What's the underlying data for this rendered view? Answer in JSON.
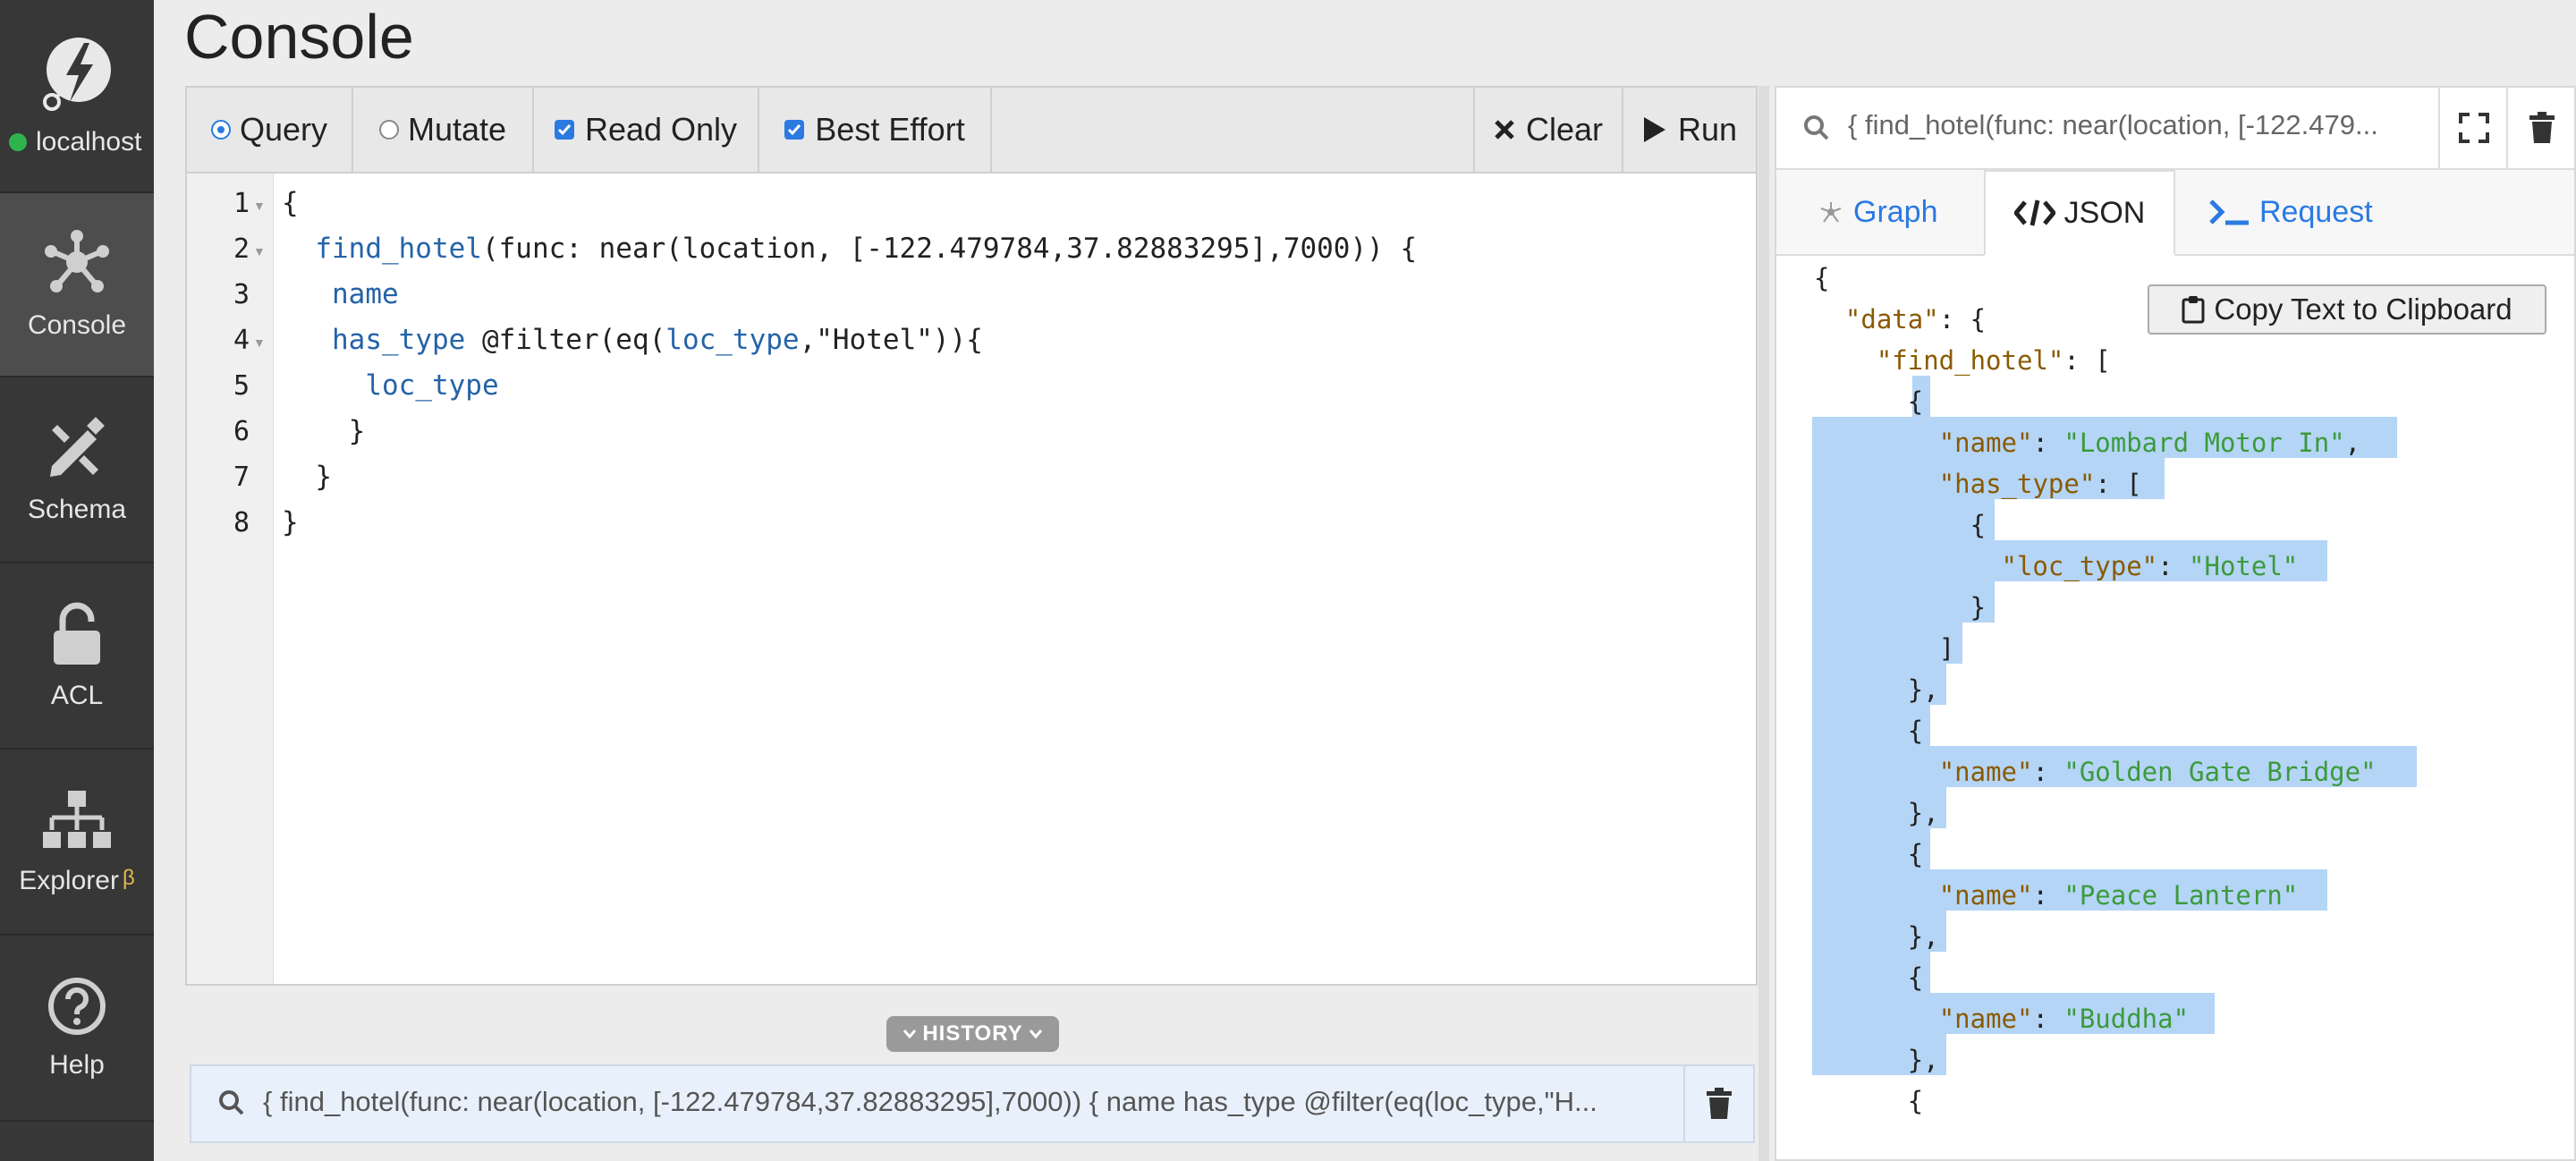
{
  "sidebar": {
    "connection": "localhost",
    "items": [
      {
        "label": "Console"
      },
      {
        "label": "Schema"
      },
      {
        "label": "ACL"
      },
      {
        "label": "Explorer",
        "badge": "β"
      },
      {
        "label": "Help"
      }
    ]
  },
  "header": {
    "title": "Console"
  },
  "toolbar": {
    "query_label": "Query",
    "mutate_label": "Mutate",
    "readonly_label": "Read Only",
    "besteffort_label": "Best Effort",
    "clear_label": "Clear",
    "run_label": "Run",
    "mode": "Query",
    "read_only": true,
    "best_effort": true
  },
  "editor": {
    "line_numbers": [
      "1",
      "2",
      "3",
      "4",
      "5",
      "6",
      "7",
      "8"
    ],
    "lines": [
      [
        "{"
      ],
      [
        "  ",
        "find_hotel",
        "(func: near(location, [-122.479784,37.82883295],7000)) {"
      ],
      [
        "   ",
        "name"
      ],
      [
        "   ",
        "has_type",
        " @filter(eq(",
        "loc_type",
        ",\"Hotel\")){"
      ],
      [
        "     ",
        "loc_type"
      ],
      [
        "    }"
      ],
      [
        "  }"
      ],
      [
        "}"
      ]
    ]
  },
  "history": {
    "label": "HISTORY",
    "text": "{ find_hotel(func: near(location, [-122.479784,37.82883295],7000)) { name has_type @filter(eq(loc_type,\"H..."
  },
  "result": {
    "query": "{ find_hotel(func: near(location, [-122.479...",
    "tabs": [
      {
        "label": "Graph"
      },
      {
        "label": "JSON"
      },
      {
        "label": "Request"
      }
    ],
    "active_tab": "JSON",
    "copy_label": "Copy Text to Clipboard",
    "json_lines": [
      {
        "indent": "",
        "key": "",
        "sep": "",
        "val": "",
        "tail": "{"
      },
      {
        "indent": "  ",
        "key": "\"data\"",
        "sep": ": ",
        "val": "",
        "tail": "{"
      },
      {
        "indent": "    ",
        "key": "\"find_hotel\"",
        "sep": ": ",
        "val": "",
        "tail": "["
      },
      {
        "indent": "      ",
        "key": "",
        "sep": "",
        "val": "",
        "tail": "{"
      },
      {
        "indent": "        ",
        "key": "\"name\"",
        "sep": ": ",
        "val": "\"Lombard Motor In\"",
        "tail": ","
      },
      {
        "indent": "        ",
        "key": "\"has_type\"",
        "sep": ": ",
        "val": "",
        "tail": "["
      },
      {
        "indent": "          ",
        "key": "",
        "sep": "",
        "val": "",
        "tail": "{"
      },
      {
        "indent": "            ",
        "key": "\"loc_type\"",
        "sep": ": ",
        "val": "\"Hotel\"",
        "tail": ""
      },
      {
        "indent": "          ",
        "key": "",
        "sep": "",
        "val": "",
        "tail": "}"
      },
      {
        "indent": "        ",
        "key": "",
        "sep": "",
        "val": "",
        "tail": "]"
      },
      {
        "indent": "      ",
        "key": "",
        "sep": "",
        "val": "",
        "tail": "},"
      },
      {
        "indent": "      ",
        "key": "",
        "sep": "",
        "val": "",
        "tail": "{"
      },
      {
        "indent": "        ",
        "key": "\"name\"",
        "sep": ": ",
        "val": "\"Golden Gate Bridge\"",
        "tail": ""
      },
      {
        "indent": "      ",
        "key": "",
        "sep": "",
        "val": "",
        "tail": "},"
      },
      {
        "indent": "      ",
        "key": "",
        "sep": "",
        "val": "",
        "tail": "{"
      },
      {
        "indent": "        ",
        "key": "\"name\"",
        "sep": ": ",
        "val": "\"Peace Lantern\"",
        "tail": ""
      },
      {
        "indent": "      ",
        "key": "",
        "sep": "",
        "val": "",
        "tail": "},"
      },
      {
        "indent": "      ",
        "key": "",
        "sep": "",
        "val": "",
        "tail": "{"
      },
      {
        "indent": "        ",
        "key": "\"name\"",
        "sep": ": ",
        "val": "\"Buddha\"",
        "tail": ""
      },
      {
        "indent": "      ",
        "key": "",
        "sep": "",
        "val": "",
        "tail": "},"
      },
      {
        "indent": "      ",
        "key": "",
        "sep": "",
        "val": "",
        "tail": "{"
      }
    ]
  },
  "colors": {
    "sidebar": "#373737",
    "accent": "#2a7ae2",
    "selection": "#b4d5f6",
    "json_key": "#8a5a00",
    "json_string": "#3c9a3c"
  },
  "icons": [
    "dgraph-logo-icon",
    "console-icon",
    "schema-icon",
    "acl-lock-icon",
    "explorer-icon",
    "help-icon",
    "clear-x-icon",
    "run-play-icon",
    "search-icon",
    "fullscreen-icon",
    "trash-icon",
    "graph-icon",
    "json-code-icon",
    "request-terminal-icon",
    "clipboard-icon",
    "chevron-down-icon"
  ]
}
